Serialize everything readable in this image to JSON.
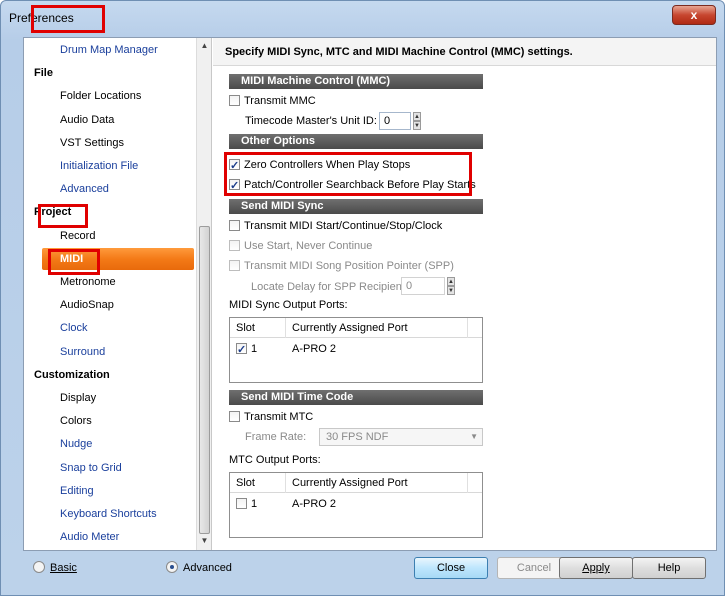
{
  "window": {
    "title": "Preferences",
    "close_symbol": "x"
  },
  "sidebar": {
    "items": [
      {
        "label": "Drum Map Manager",
        "kind": "link"
      },
      {
        "label": "File",
        "kind": "group"
      },
      {
        "label": "Folder Locations",
        "kind": "item"
      },
      {
        "label": "Audio Data",
        "kind": "item"
      },
      {
        "label": "VST Settings",
        "kind": "item"
      },
      {
        "label": "Initialization File",
        "kind": "link"
      },
      {
        "label": "Advanced",
        "kind": "link"
      },
      {
        "label": "Project",
        "kind": "group"
      },
      {
        "label": "Record",
        "kind": "item"
      },
      {
        "label": "MIDI",
        "kind": "selected"
      },
      {
        "label": "Metronome",
        "kind": "item"
      },
      {
        "label": "AudioSnap",
        "kind": "item"
      },
      {
        "label": "Clock",
        "kind": "link"
      },
      {
        "label": "Surround",
        "kind": "link"
      },
      {
        "label": "Customization",
        "kind": "group"
      },
      {
        "label": "Display",
        "kind": "item"
      },
      {
        "label": "Colors",
        "kind": "item"
      },
      {
        "label": "Nudge",
        "kind": "link"
      },
      {
        "label": "Snap to Grid",
        "kind": "link"
      },
      {
        "label": "Editing",
        "kind": "link"
      },
      {
        "label": "Keyboard Shortcuts",
        "kind": "link"
      },
      {
        "label": "Audio Meter",
        "kind": "link"
      }
    ]
  },
  "content": {
    "header": "Specify MIDI Sync, MTC and MIDI Machine Control (MMC) settings.",
    "mmc": {
      "title": "MIDI Machine Control (MMC)",
      "transmit_mmc": "Transmit MMC",
      "transmit_mmc_checked": false,
      "unit_id_label": "Timecode Master's Unit ID:",
      "unit_id_value": "0"
    },
    "other": {
      "title": "Other Options",
      "zero_controllers": "Zero Controllers When Play Stops",
      "zero_controllers_checked": true,
      "patch_searchback": "Patch/Controller Searchback Before Play Starts",
      "patch_searchback_checked": true
    },
    "sync": {
      "title": "Send MIDI Sync",
      "transmit_start": "Transmit MIDI Start/Continue/Stop/Clock",
      "transmit_start_checked": false,
      "use_start": "Use Start, Never Continue",
      "use_start_checked": false,
      "transmit_spp": "Transmit MIDI Song Position Pointer (SPP)",
      "transmit_spp_checked": false,
      "locate_delay_label": "Locate Delay for SPP Recipient:",
      "locate_delay_value": "0",
      "ports_label": "MIDI Sync Output Ports:",
      "col_slot": "Slot",
      "col_port": "Currently Assigned Port",
      "row_slot": "1",
      "row_port": "A-PRO 2",
      "row_checked": true
    },
    "mtc": {
      "title": "Send MIDI Time Code",
      "transmit_mtc": "Transmit MTC",
      "transmit_mtc_checked": false,
      "frame_rate_label": "Frame Rate:",
      "frame_rate_value": "30 FPS NDF",
      "ports_label": "MTC Output Ports:",
      "col_slot": "Slot",
      "col_port": "Currently Assigned Port",
      "row_slot": "1",
      "row_port": "A-PRO 2",
      "row_checked": false
    }
  },
  "bottom": {
    "basic_label": "Basic",
    "advanced_label": "Advanced",
    "selected_mode": "Advanced",
    "close_label": "Close",
    "cancel_label": "Cancel",
    "apply_label": "Apply",
    "help_label": "Help"
  },
  "colors": {
    "highlight": "#e00000",
    "selected_item": "#f47a17",
    "link_text": "#1a3f9c"
  }
}
